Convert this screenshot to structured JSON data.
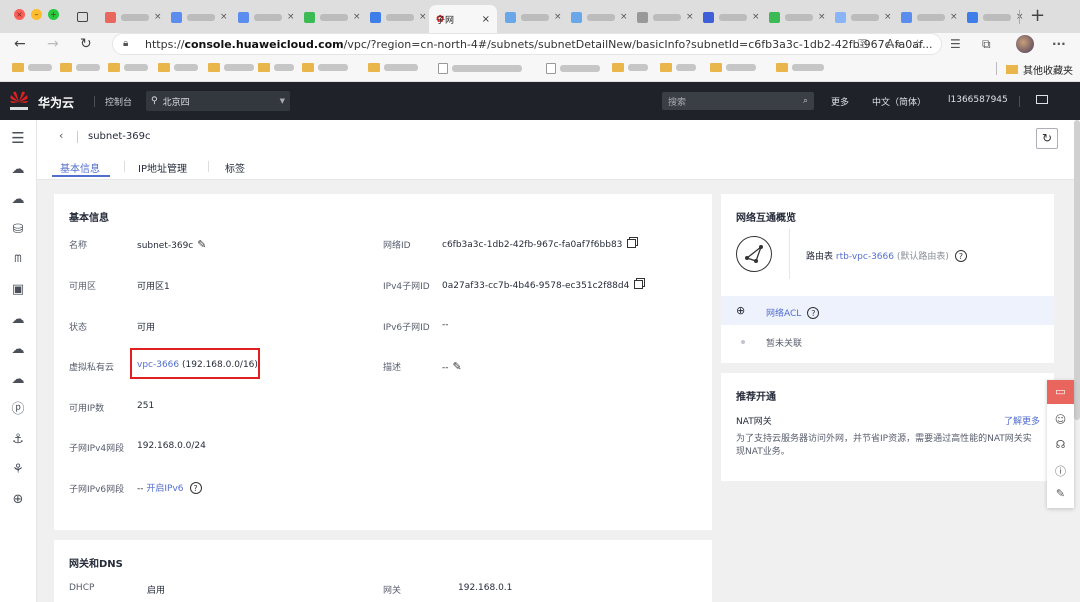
{
  "browser": {
    "active_tab_label": "子网",
    "url_prefix": "https://",
    "url_host": "console.huaweicloud.com",
    "url_path": "/vpc/?region=cn-north-4#/subnets/subnetDetailNew/basicInfo?subnetId=c6fb3a3c-1db2-42fb-967c-fa0af...",
    "other_bookmarks": "其他收藏夹"
  },
  "console_header": {
    "brand": "华为云",
    "console": "控制台",
    "region": "北京四",
    "search_placeholder": "搜索",
    "more": "更多",
    "language": "中文（简体）",
    "user": "l1366587945"
  },
  "page": {
    "title": "subnet-369c",
    "tabs": [
      "基本信息",
      "IP地址管理",
      "标签"
    ]
  },
  "basic_info": {
    "title": "基本信息",
    "name_label": "名称",
    "name_value": "subnet-369c",
    "az_label": "可用区",
    "az_value": "可用区1",
    "status_label": "状态",
    "status_value": "可用",
    "vpc_label": "虚拟私有云",
    "vpc_link": "vpc-3666",
    "vpc_cidr": "(192.168.0.0/16)",
    "available_ip_label": "可用IP数",
    "available_ip_value": "251",
    "ipv4_cidr_label": "子网IPv4网段",
    "ipv4_cidr_value": "192.168.0.0/24",
    "ipv6_cidr_label": "子网IPv6网段",
    "ipv6_cidr_dash": "--",
    "ipv6_enable_link": "开启IPv6",
    "network_id_label": "网络ID",
    "network_id_value": "c6fb3a3c-1db2-42fb-967c-fa0af7f6bb83",
    "ipv4_subnet_id_label": "IPv4子网ID",
    "ipv4_subnet_id_value": "0a27af33-cc7b-4b46-9578-ec351c2f88d4",
    "ipv6_subnet_id_label": "IPv6子网ID",
    "ipv6_subnet_id_value": "--",
    "desc_label": "描述",
    "desc_value": "--"
  },
  "gateway_dns": {
    "title": "网关和DNS",
    "dhcp_label": "DHCP",
    "dhcp_value": "启用",
    "gateway_label": "网关",
    "gateway_value": "192.168.0.1"
  },
  "interconnect": {
    "title": "网络互通概览",
    "route_table_label": "路由表",
    "route_table_link": "rtb-vpc-3666",
    "route_table_note": "(默认路由表)",
    "acl_link": "网络ACL",
    "acl_status": "暂未关联"
  },
  "recommend": {
    "title": "推荐开通",
    "nat_title": "NAT网关",
    "learn_more": "了解更多",
    "nat_desc_line1": "为了支持云服务器访问外网，并节省IP资源，需要通过高性能的NAT网关实",
    "nat_desc_line2": "现NAT业务。"
  },
  "colors": {
    "accent": "#526ecc",
    "header_bg": "#1f2329",
    "highlight_box": "#e02020"
  }
}
